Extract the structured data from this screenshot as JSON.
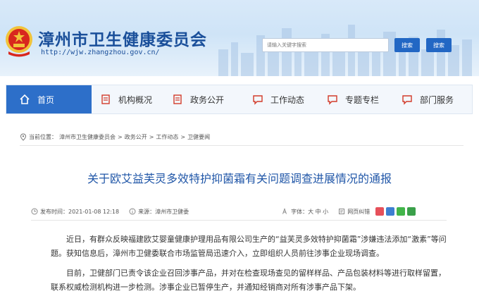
{
  "header": {
    "title": "漳州市卫生健康委员会",
    "url": "http://wjw.zhangzhou.gov.cn/",
    "search_placeholder": "请输入关键字搜索",
    "search_button_1": "搜索",
    "search_button_2": "搜索"
  },
  "nav": {
    "items": [
      {
        "label": "首页",
        "icon": "home-icon"
      },
      {
        "label": "机构概况",
        "icon": "document-icon"
      },
      {
        "label": "政务公开",
        "icon": "document-icon"
      },
      {
        "label": "工作动态",
        "icon": "chat-icon"
      },
      {
        "label": "专题专栏",
        "icon": "chat-icon"
      },
      {
        "label": "部门服务",
        "icon": "chat-icon"
      }
    ]
  },
  "breadcrumb": {
    "prefix": "当前位置：",
    "items": [
      "漳州市卫生健康委员会",
      "政务公开",
      "工作动态",
      "卫健要闻"
    ],
    "separator": ">"
  },
  "article": {
    "title": "关于欧艾益芙灵多效特护抑菌霜有关问题调查进展情况的通报",
    "meta": {
      "published": "发布时间：2021-01-08 12:18",
      "source": "来源：漳州市卫健委",
      "font_size": "字体：大 中 小",
      "error_report": "网页纠错"
    },
    "paragraphs": [
      "近日，有群众反映福建欧艾婴童健康护理用品有限公司生产的“益芙灵多效特护抑菌霜”涉嫌违法添加“激素”等问题。获知信息后，漳州市卫健委联合市场监管局迅速介入，立即组织人员前往涉事企业现场调查。",
      "目前，卫健部门已责令该企业召回涉事产品，并对在检查现场查见的留样样品、产品包装材料等进行取样留置，联系权威检测机构进一步检测。涉事企业已暂停生产，并通知经销商对所有涉事产品下架。"
    ]
  },
  "colors": {
    "brand_blue": "#2d6fc9",
    "title_blue": "#2157a8",
    "header_bg": "#d8e9f9",
    "emblem_red": "#d8271e",
    "emblem_gold": "#f1c33a"
  }
}
